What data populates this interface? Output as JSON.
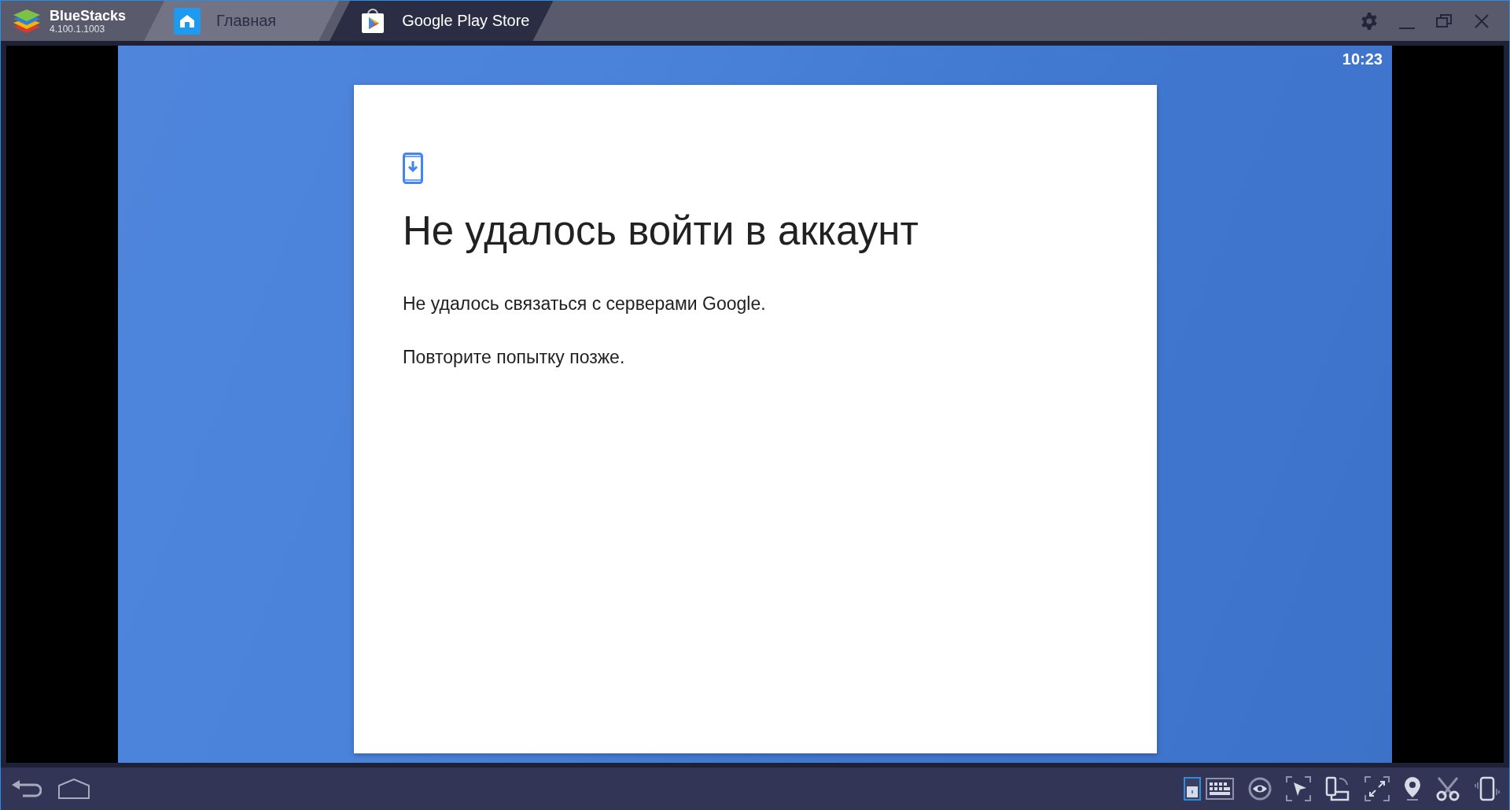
{
  "app": {
    "name": "BlueStacks",
    "version": "4.100.1.1003"
  },
  "tabs": [
    {
      "label": "Главная",
      "kind": "home",
      "selected": false
    },
    {
      "label": "Google Play Store",
      "kind": "store",
      "selected": true
    }
  ],
  "status_bar": {
    "time": "10:23"
  },
  "dialog": {
    "title": "Не удалось войти в аккаунт",
    "paragraphs": [
      "Не удалось связаться с серверами Google.",
      "Повторите попытку позже."
    ]
  }
}
